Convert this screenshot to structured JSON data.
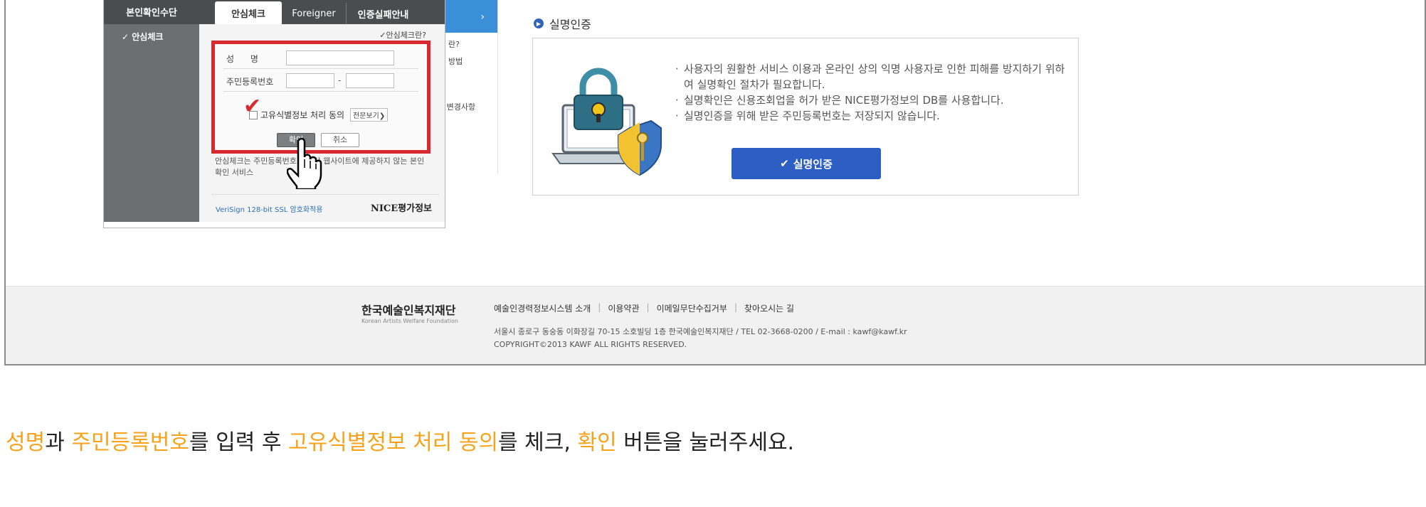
{
  "popup": {
    "left_header": "본인확인수단",
    "left_item": "✓ 안심체크",
    "tabs": [
      "안심체크",
      "Foreigner",
      "인증실패안내"
    ],
    "what_link": "✓안심체크란?",
    "fields": {
      "name_label": "성      명",
      "rrn_label": "주민등록번호",
      "rrn_dash": "-"
    },
    "agree_label": "고유식별정보 처리 동의",
    "full_view": "전문보기",
    "ok_button": "확인",
    "cancel_button": "취소",
    "notice": "안심체크는 주민등록번호를 해당 웹사이트에 제공하지 않는 본인확인 서비스",
    "ssl_text": "VeriSign 128-bit SSL 암호화적용",
    "nice_logo": "NICE평가정보"
  },
  "bg_menu": {
    "arrow": "›",
    "items": [
      "란?",
      "방법",
      "경 변경사항"
    ]
  },
  "auth": {
    "title": "실명인증",
    "bullets": [
      "사용자의 원활한 서비스 이용과 온라인 상의 익명 사용자로 인한 피해를 방지하기 위하여 실명확인 절차가 필요합니다.",
      "실명확인은 신용조회업을 허가 받은 NICE평가정보의 DB를 사용합니다.",
      "실명인증을 위해 받은 주민등록번호는 저장되지 않습니다."
    ],
    "button_label": "실명인증",
    "button_color": "#2c5ec4"
  },
  "footer": {
    "org_name": "한국예술인복지재단",
    "org_en": "Korean Artists Welfare Foundation",
    "links": [
      "예술인경력정보시스템 소개",
      "이용약관",
      "이메일무단수집거부",
      "찾아오시는 길"
    ],
    "address": "서울시 종로구 동숭동 이화장길 70-15 소호빌딩 1층 한국예술인복지재단 / TEL 02-3668-0200 / E-mail : kawf@kawf.kr",
    "copyright": "COPYRIGHT©2013 KAWF ALL RIGHTS RESERVED."
  },
  "caption": {
    "p1": "성명",
    "p2": "과 ",
    "p3": "주민등록번호",
    "p4": "를 입력 후 ",
    "p5": "고유식별정보 처리 동의",
    "p6": "를 체크, ",
    "p7": "확인",
    "p8": " 버튼을 눌러주세요.",
    "highlight_color": "#f7a21b"
  }
}
